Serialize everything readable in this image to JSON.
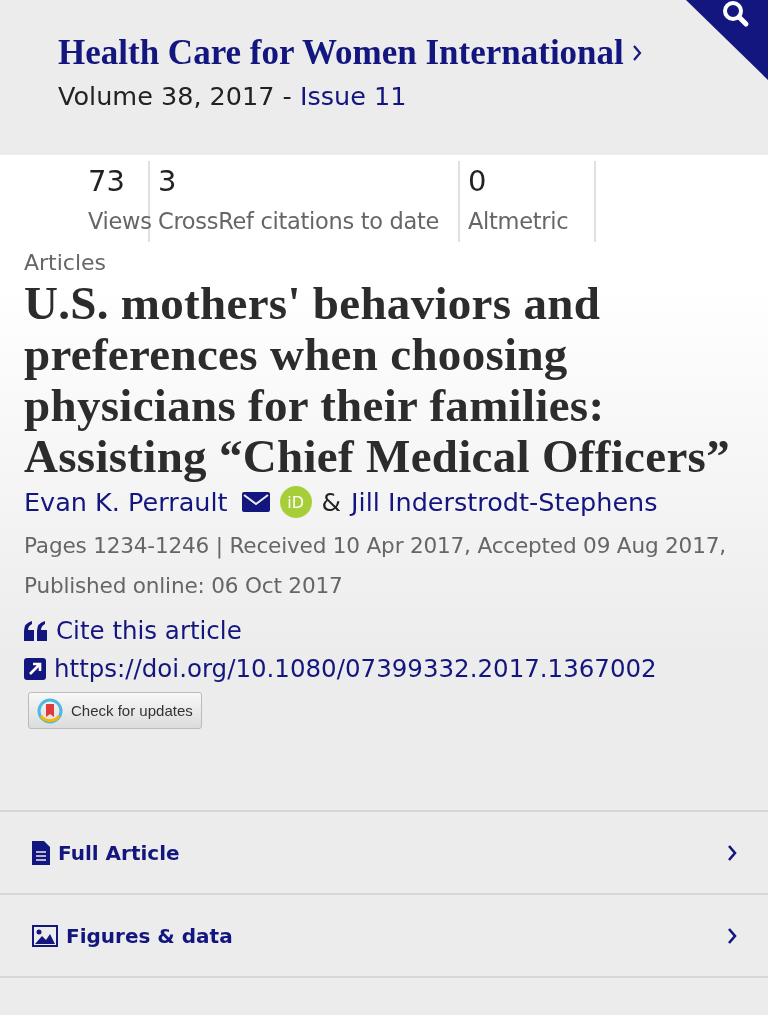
{
  "journal": {
    "title": "Health Care for Women International",
    "volume": "Volume 38, 2017 - ",
    "issue": "Issue 11"
  },
  "metrics": [
    {
      "value": "73",
      "label": "Views"
    },
    {
      "value": "3",
      "label": "CrossRef citations to date"
    },
    {
      "value": "0",
      "label": "Altmetric"
    }
  ],
  "article": {
    "type": "Articles",
    "title": "U.S. mothers' behaviors and preferences when choosing physicians for their families: Assisting “Chief Medical Officers”",
    "authors": [
      {
        "name": "Evan K. Perrault",
        "email": true,
        "orcid": "iD"
      },
      {
        "name": "Jill Inderstrodt-Stephens",
        "email": false
      }
    ],
    "author_separator": "&",
    "dates": "Pages 1234-1246 | Received 10 Apr 2017, Accepted 09 Aug 2017, Published online: 06 Oct 2017",
    "cite": "Cite this article",
    "doi": "https://doi.org/10.1080/07399332.2017.1367002",
    "updates": "Check for updates"
  },
  "sections": [
    {
      "label": "Full Article",
      "kind": "document"
    },
    {
      "label": "Figures & data",
      "kind": "image"
    }
  ]
}
